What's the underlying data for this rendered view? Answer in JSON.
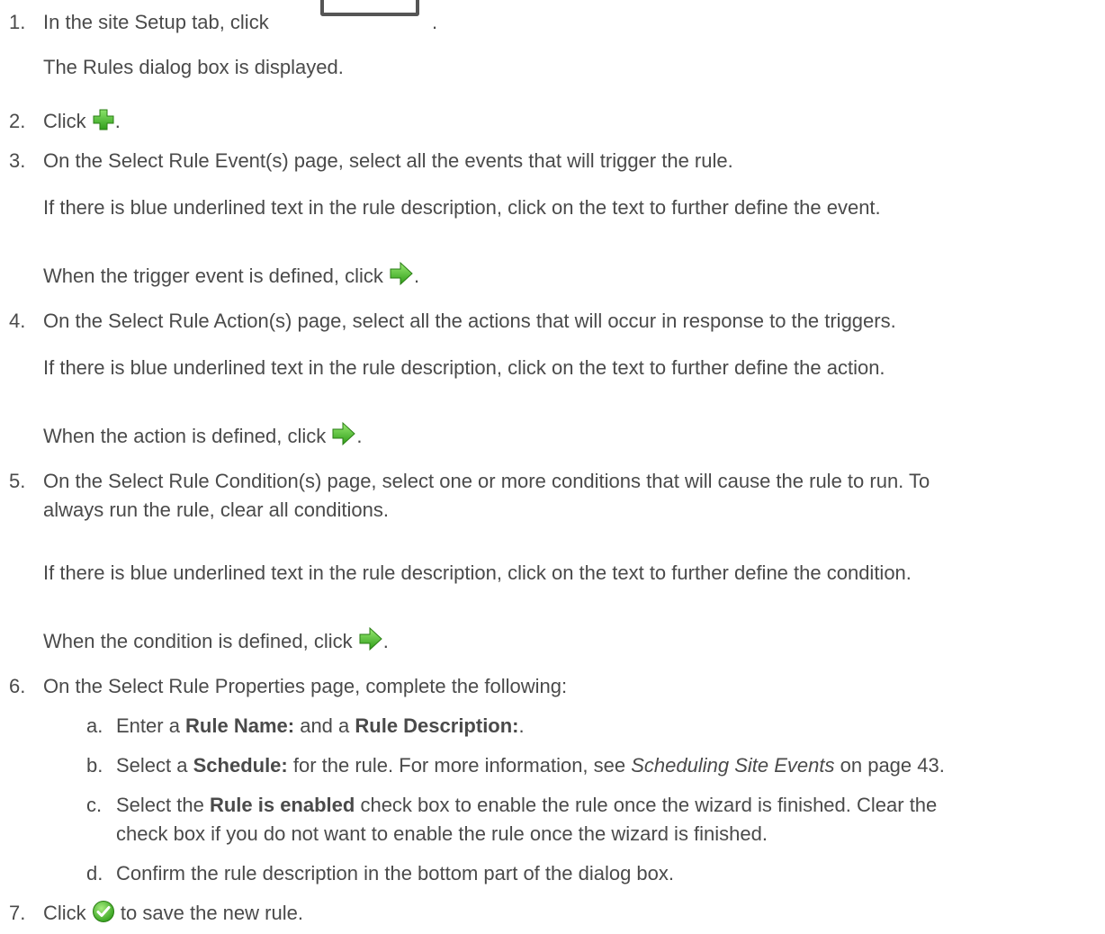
{
  "steps": [
    {
      "num": "1.",
      "text_before": "In the site Setup tab, click",
      "text_after": ".",
      "note": "The Rules dialog box is displayed."
    },
    {
      "num": "2.",
      "text_before": "Click",
      "text_after": "."
    },
    {
      "num": "3.",
      "text": "On the Select Rule Event(s) page, select all the events that will trigger the rule.",
      "note": "If there is blue underlined text in the rule description, click on the text to further define the event.",
      "note2_before": "When the trigger event is defined, click",
      "note2_after": "."
    },
    {
      "num": "4.",
      "text": "On the Select Rule Action(s) page, select all the actions that will occur in response to the triggers.",
      "note": "If there is blue underlined text in the rule description, click on the text to further define the action.",
      "note2_before": "When the action is defined, click",
      "note2_after": "."
    },
    {
      "num": "5.",
      "text_line1": "On the Select Rule Condition(s) page, select one or more conditions that will cause the rule to run. To",
      "text_line2": "always run the rule, clear all conditions.",
      "note": "If there is blue underlined text in the rule description, click on the text to further define the condition.",
      "note2_before": "When the condition is defined, click",
      "note2_after": "."
    },
    {
      "num": "6.",
      "text": "On the Select Rule Properties page, complete the following:"
    },
    {
      "num": "7.",
      "text_before": "Click",
      "text_after": "to save the new rule."
    }
  ],
  "substeps": [
    {
      "letter": "a.",
      "p1": "Enter a ",
      "b1": "Rule Name:",
      "p2": " and a ",
      "b2": "Rule Description:",
      "p3": "."
    },
    {
      "letter": "b.",
      "p1": "Select a ",
      "b1": "Schedule:",
      "p2": " for the rule. For more information, see ",
      "i1": "Scheduling Site Events",
      "p3": " on page 43."
    },
    {
      "letter": "c.",
      "p1": "Select the ",
      "b1": "Rule is enabled",
      "p2": " check box to enable the rule once the wizard is finished. Clear the",
      "line2": "check box if you do not want to enable the rule once the wizard is finished."
    },
    {
      "letter": "d.",
      "p1": "Confirm the rule description in the bottom part of the dialog box."
    }
  ],
  "icons": {
    "add": "green-plus-icon",
    "next": "green-arrow-right-icon",
    "finish": "green-checkmark-icon",
    "accent_green": "#3fbf22",
    "text_color": "#4a4a4a"
  }
}
